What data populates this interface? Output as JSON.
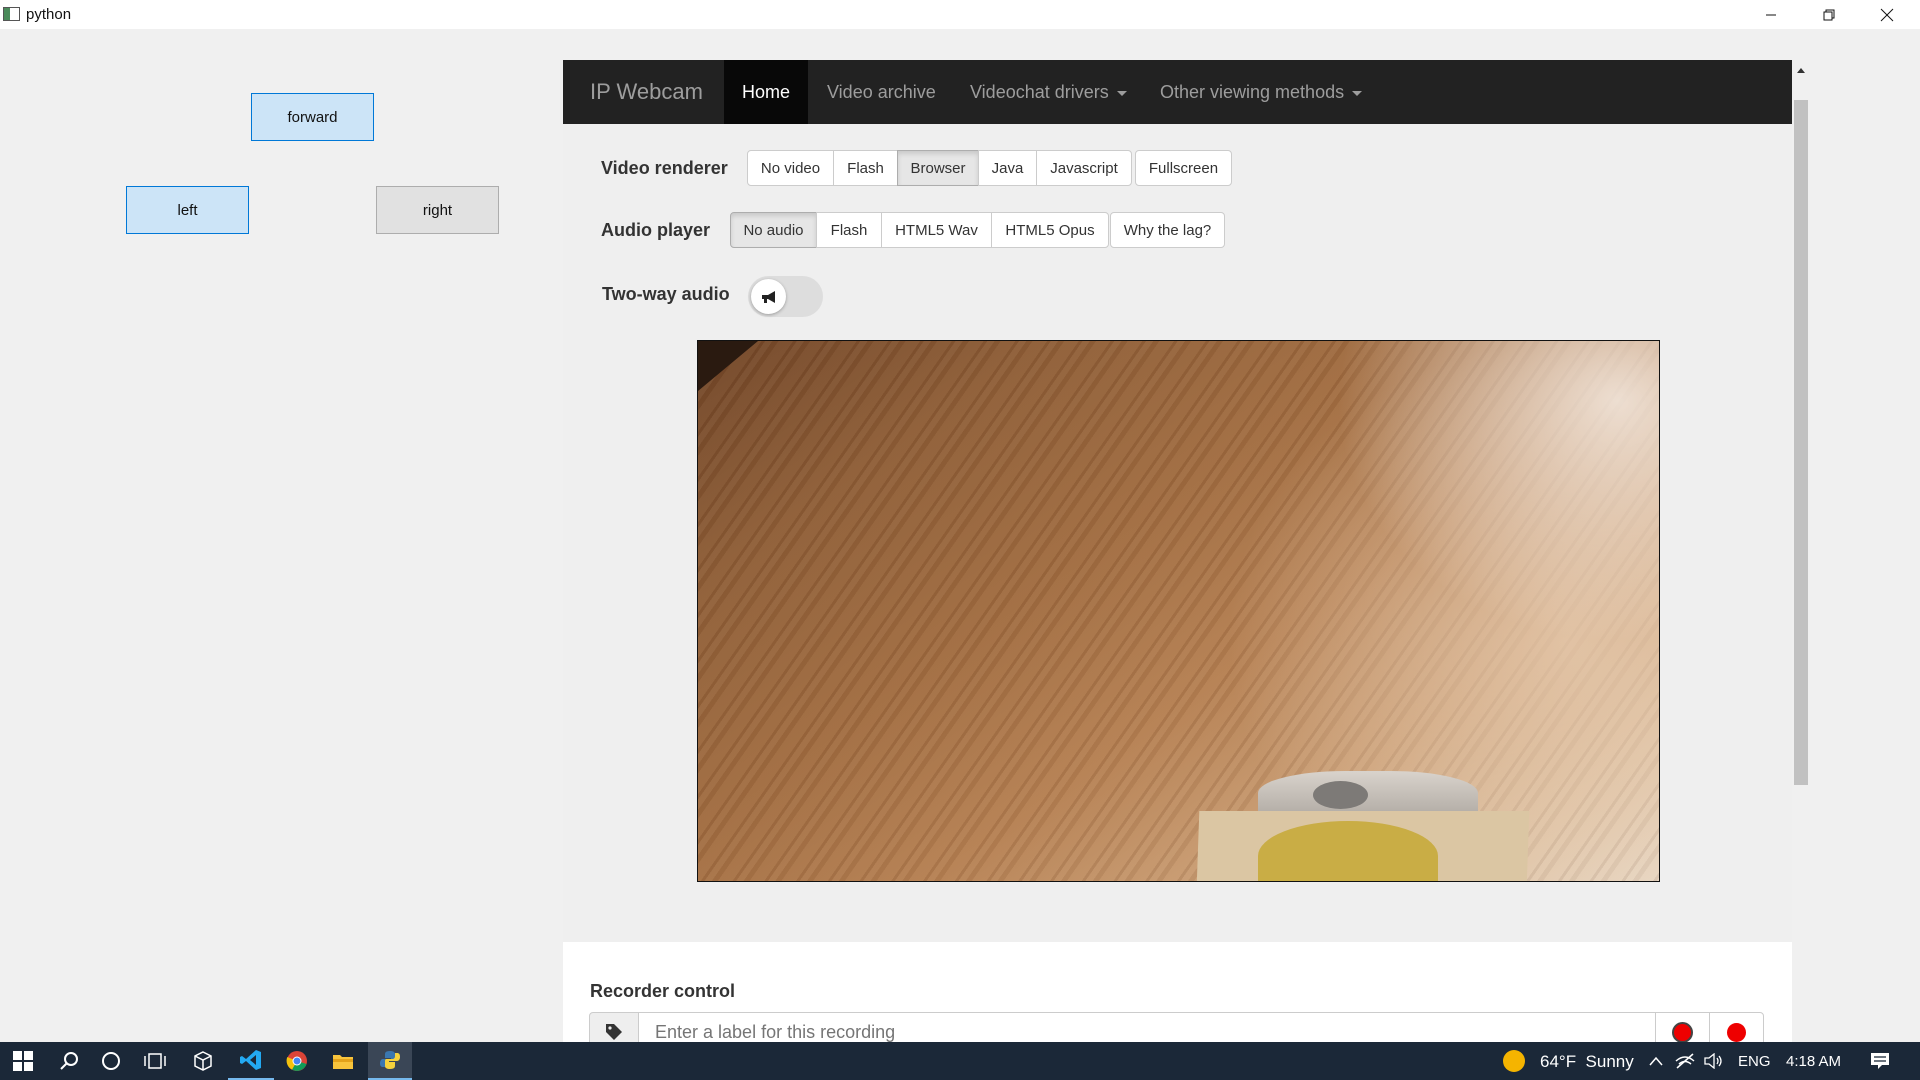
{
  "window": {
    "title": "python"
  },
  "controls": {
    "forward": "forward",
    "left": "left",
    "right": "right"
  },
  "webpage": {
    "brand": "IP Webcam",
    "nav": [
      {
        "label": "Home",
        "active": true,
        "dropdown": false
      },
      {
        "label": "Video archive",
        "active": false,
        "dropdown": false
      },
      {
        "label": "Videochat drivers",
        "active": false,
        "dropdown": true
      },
      {
        "label": "Other viewing methods",
        "active": false,
        "dropdown": true
      }
    ],
    "video_renderer": {
      "label": "Video renderer",
      "options": [
        "No video",
        "Flash",
        "Browser",
        "Java",
        "Javascript"
      ],
      "selected": "Browser",
      "fullscreen": "Fullscreen"
    },
    "audio_player": {
      "label": "Audio player",
      "options": [
        "No audio",
        "Flash",
        "HTML5 Wav",
        "HTML5 Opus"
      ],
      "selected": "No audio",
      "help": "Why the lag?"
    },
    "two_way_audio": {
      "label": "Two-way audio",
      "enabled": false
    },
    "recorder": {
      "title": "Recorder control",
      "label_placeholder": "Enter a label for this recording"
    }
  },
  "taskbar": {
    "weather": "64°F  Sunny",
    "language": "ENG",
    "time": "4:18 AM"
  },
  "icons": {
    "tag": "tag-icon",
    "megaphone": "megaphone-icon",
    "record": "record-icon"
  },
  "colors": {
    "navbar_bg": "#222222",
    "nav_active_bg": "#080808",
    "focus_button": "#cce4f7",
    "record_red": "#ee0000",
    "taskbar_bg": "#1b2838"
  }
}
